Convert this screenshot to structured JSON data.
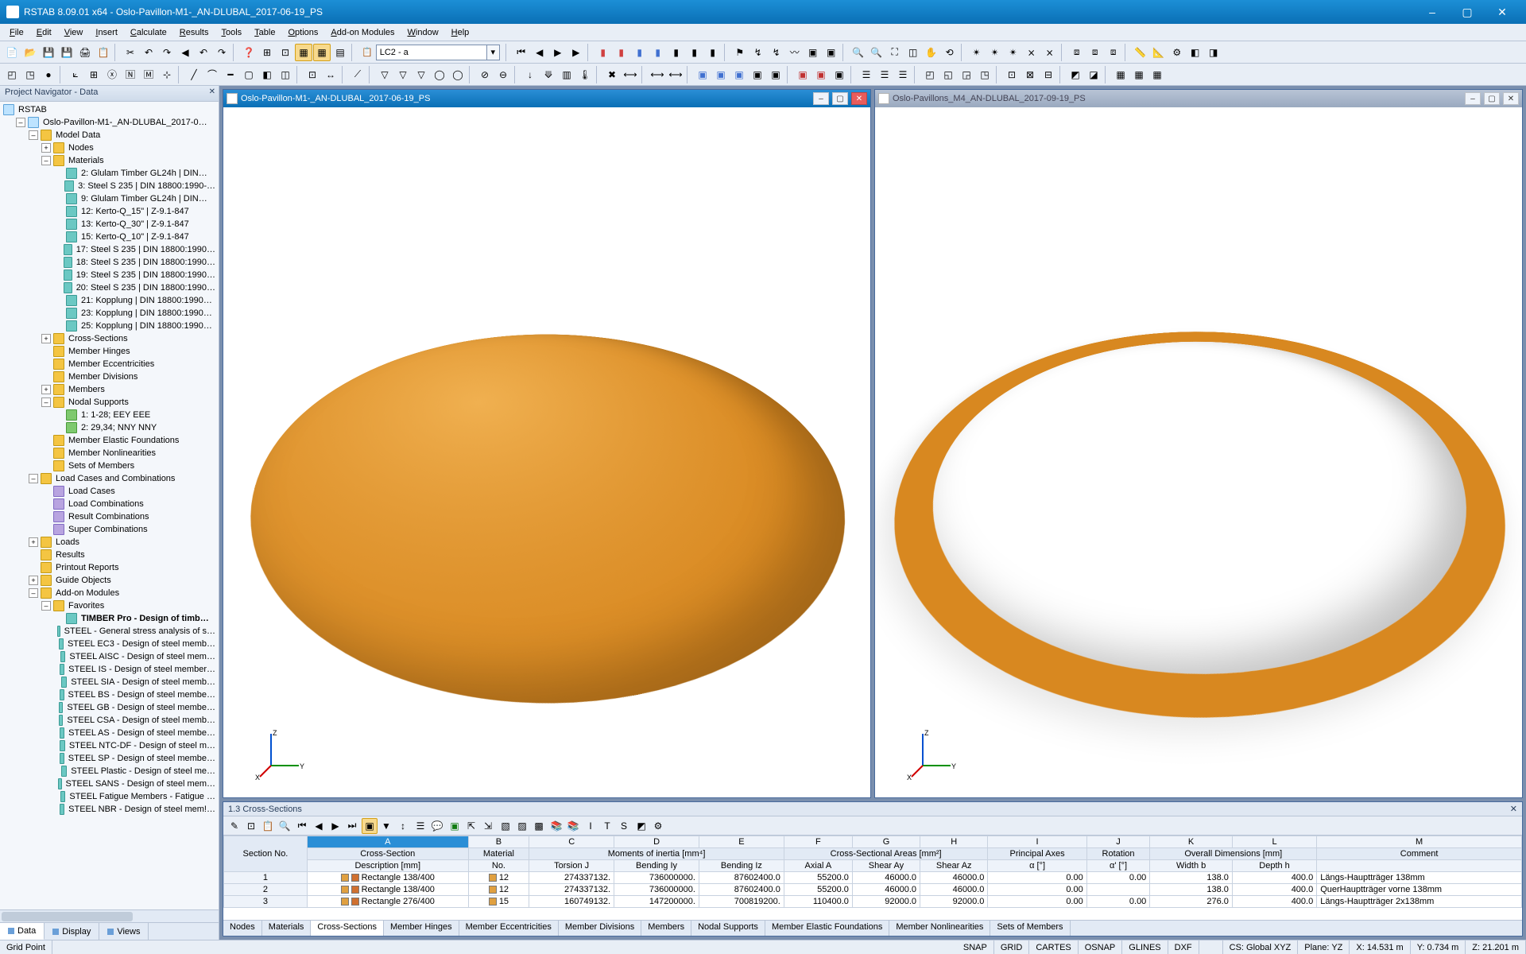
{
  "app": {
    "title": "RSTAB 8.09.01 x64 - Oslo-Pavillon-M1-_AN-DLUBAL_2017-06-19_PS",
    "win_min": "–",
    "win_max": "▢",
    "win_close": "✕"
  },
  "menu": [
    "File",
    "Edit",
    "View",
    "Insert",
    "Calculate",
    "Results",
    "Tools",
    "Table",
    "Options",
    "Add-on Modules",
    "Window",
    "Help"
  ],
  "lc_combo": {
    "value": "LC2 - a"
  },
  "navigator": {
    "title": "Project Navigator - Data",
    "root": "RSTAB",
    "project": "Oslo-Pavillon-M1-_AN-DLUBAL_2017-0…",
    "model_data": "Model Data",
    "nodes": "Nodes",
    "materials": "Materials",
    "materials_items": [
      "2: Glulam Timber GL24h | DIN…",
      "3: Steel S 235 | DIN 18800:1990-…",
      "9: Glulam Timber GL24h | DIN…",
      "12: Kerto-Q_15\" | Z-9.1-847",
      "13: Kerto-Q_30\" | Z-9.1-847",
      "15: Kerto-Q_10\" | Z-9.1-847",
      "17: Steel S 235 | DIN 18800:1990…",
      "18: Steel S 235 | DIN 18800:1990…",
      "19: Steel S 235 | DIN 18800:1990…",
      "20: Steel S 235 | DIN 18800:1990…",
      "21: Kopplung | DIN 18800:1990…",
      "23: Kopplung | DIN 18800:1990…",
      "25: Kopplung | DIN 18800:1990…"
    ],
    "cross_sections": "Cross-Sections",
    "member_hinges": "Member Hinges",
    "member_ecc": "Member Eccentricities",
    "member_div": "Member Divisions",
    "members": "Members",
    "nodal_supports": "Nodal Supports",
    "nodal_supports_items": [
      "1: 1-28; EEY EEE",
      "2: 29,34; NNY NNY"
    ],
    "mef": "Member Elastic Foundations",
    "mnl": "Member Nonlinearities",
    "som": "Sets of Members",
    "lcc": "Load Cases and Combinations",
    "lcc_items": [
      "Load Cases",
      "Load Combinations",
      "Result Combinations",
      "Super Combinations"
    ],
    "loads": "Loads",
    "results": "Results",
    "printout": "Printout Reports",
    "guide": "Guide Objects",
    "addon": "Add-on Modules",
    "favorites": "Favorites",
    "fav_items": [
      "TIMBER Pro - Design of timb…",
      "STEEL - General stress analysis of s…",
      "STEEL EC3 - Design of steel memb…",
      "STEEL AISC - Design of steel mem…",
      "STEEL IS - Design of steel member…",
      "STEEL SIA - Design of steel memb…",
      "STEEL BS - Design of steel membe…",
      "STEEL GB - Design of steel membe…",
      "STEEL CSA - Design of steel memb…",
      "STEEL AS - Design of steel membe…",
      "STEEL NTC-DF - Design of steel m…",
      "STEEL SP - Design of steel membe…",
      "STEEL Plastic - Design of steel me…",
      "STEEL SANS - Design of steel mem…",
      "STEEL Fatigue Members - Fatigue …",
      "STEEL NBR - Design of steel mem!…"
    ],
    "tabs": [
      "Data",
      "Display",
      "Views"
    ]
  },
  "child_windows": {
    "left": "Oslo-Pavillon-M1-_AN-DLUBAL_2017-06-19_PS",
    "right": "Oslo-Pavillons_M4_AN-DLUBAL_2017-09-19_PS"
  },
  "table": {
    "title": "1.3 Cross-Sections",
    "col_letters": [
      "A",
      "B",
      "C",
      "D",
      "E",
      "F",
      "G",
      "H",
      "I",
      "J",
      "K",
      "L",
      "M"
    ],
    "group_headers": {
      "section_no": "Section No.",
      "cross_section": "Cross-Section",
      "material": "Material",
      "moments": "Moments of inertia [mm⁴]",
      "areas": "Cross-Sectional Areas [mm²]",
      "principal": "Principal Axes",
      "rotation": "Rotation",
      "overall": "Overall Dimensions [mm]",
      "comment": "Comment"
    },
    "sub_headers": {
      "desc": "Description [mm]",
      "no": "No.",
      "torsion": "Torsion J",
      "iy": "Bending Iy",
      "iz": "Bending Iz",
      "axial": "Axial A",
      "ay": "Shear Ay",
      "az": "Shear Az",
      "alpha": "α [°]",
      "alpha2": "α' [°]",
      "width": "Width b",
      "depth": "Depth h"
    },
    "rows": [
      {
        "n": "1",
        "desc": "Rectangle 138/400",
        "mat": "12",
        "j": "274337132.",
        "iy": "736000000.",
        "iz": "87602400.0",
        "a": "55200.0",
        "ay": "46000.0",
        "az": "46000.0",
        "alpha": "0.00",
        "alpha2": "0.00",
        "w": "138.0",
        "h": "400.0",
        "c": "Längs-Hauptträger 138mm"
      },
      {
        "n": "2",
        "desc": "Rectangle 138/400",
        "mat": "12",
        "j": "274337132.",
        "iy": "736000000.",
        "iz": "87602400.0",
        "a": "55200.0",
        "ay": "46000.0",
        "az": "46000.0",
        "alpha": "0.00",
        "alpha2": "",
        "w": "138.0",
        "h": "400.0",
        "c": "QuerHauptträger vorne 138mm"
      },
      {
        "n": "3",
        "desc": "Rectangle 276/400",
        "mat": "15",
        "j": "160749132.",
        "iy": "147200000.",
        "iz": "700819200.",
        "a": "110400.0",
        "ay": "92000.0",
        "az": "92000.0",
        "alpha": "0.00",
        "alpha2": "0.00",
        "w": "276.0",
        "h": "400.0",
        "c": "Längs-Hauptträger 2x138mm"
      }
    ],
    "tabs": [
      "Nodes",
      "Materials",
      "Cross-Sections",
      "Member Hinges",
      "Member Eccentricities",
      "Member Divisions",
      "Members",
      "Nodal Supports",
      "Member Elastic Foundations",
      "Member Nonlinearities",
      "Sets of Members"
    ]
  },
  "status": {
    "left": "Grid Point",
    "toggles": [
      "SNAP",
      "GRID",
      "CARTES",
      "OSNAP",
      "GLINES",
      "DXF"
    ],
    "cs": "CS: Global XYZ",
    "plane": "Plane: YZ",
    "x": "X: 14.531 m",
    "y": "Y: 0.734 m",
    "z": "Z: 21.201 m"
  }
}
